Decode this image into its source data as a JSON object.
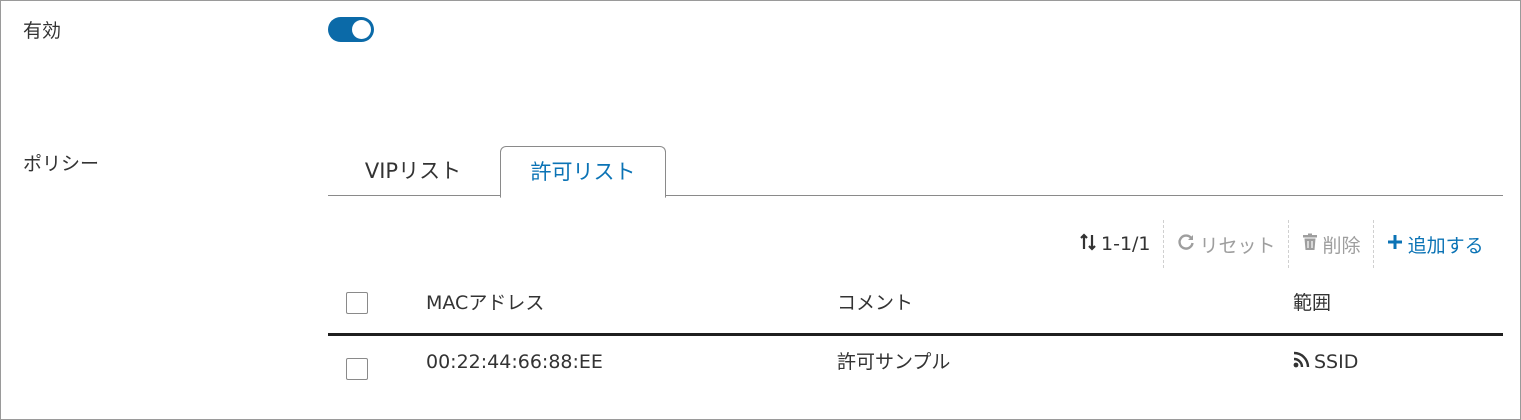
{
  "enabled": {
    "label": "有効",
    "toggle_on": true,
    "toggle_color": "#0b6aa8"
  },
  "policy": {
    "label": "ポリシー",
    "tabs": [
      {
        "label": "VIPリスト",
        "active": false
      },
      {
        "label": "許可リスト",
        "active": true
      }
    ],
    "active_tab_color": "#0b73b5"
  },
  "toolbar": {
    "count": "1-1/1",
    "count_icon": "sort-icon",
    "reset_label": "リセット",
    "reset_icon": "refresh-icon",
    "delete_label": "削除",
    "delete_icon": "trash-icon",
    "add_label": "追加する",
    "add_icon": "plus-icon"
  },
  "table": {
    "columns": [
      "MACアドレス",
      "コメント",
      "範囲"
    ],
    "rows": [
      {
        "mac": "00:22:44:66:88:EE",
        "comment": "許可サンプル",
        "scope": "SSID",
        "scope_icon": "wifi-icon"
      }
    ]
  }
}
